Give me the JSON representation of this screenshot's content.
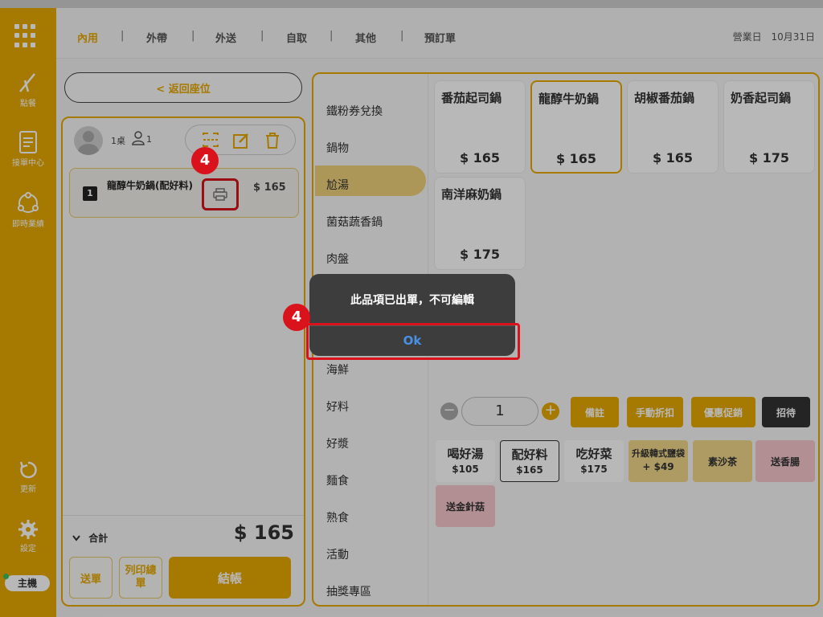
{
  "nav": {
    "tabs": [
      "內用",
      "外帶",
      "外送",
      "自取",
      "其他",
      "預訂單"
    ],
    "separator": "|",
    "business_day_label": "營業日",
    "date": "10月31日"
  },
  "sidebar": {
    "items": [
      {
        "label": "點餐",
        "icon": "pencil-icon"
      },
      {
        "label": "接單中心",
        "icon": "clipboard-icon"
      },
      {
        "label": "即時業績",
        "icon": "network-icon"
      },
      {
        "label": "更新",
        "icon": "refresh-icon"
      },
      {
        "label": "設定",
        "icon": "gear-icon"
      }
    ],
    "host_label": "主機"
  },
  "order": {
    "back_label": "< 返回座位",
    "table": "1桌",
    "guests": "1",
    "item": {
      "qty": "1",
      "name": "龍醇牛奶鍋(配好料)",
      "price": "$ 165"
    },
    "total_label": "合計",
    "total_value": "$ 165",
    "send_label": "送單",
    "print_total_label": "列印總單",
    "checkout_label": "結帳"
  },
  "menu": {
    "categories": [
      "鐵粉券兌換",
      "鍋物",
      "尬湯",
      "菌菇蔬香鍋",
      "肉盤",
      "海鮮",
      "好料",
      "好漿",
      "麵食",
      "熟食",
      "活動",
      "抽獎專區"
    ],
    "active_category": "尬湯",
    "dishes": [
      {
        "name": "番茄起司鍋",
        "price": "$ 165"
      },
      {
        "name": "龍醇牛奶鍋",
        "price": "$ 165"
      },
      {
        "name": "胡椒番茄鍋",
        "price": "$ 165"
      },
      {
        "name": "奶香起司鍋",
        "price": "$ 175"
      },
      {
        "name": "南洋麻奶鍋",
        "price": "$ 175"
      }
    ],
    "quantity": "1",
    "actions": [
      "備註",
      "手動折扣",
      "優惠促銷",
      "招待"
    ],
    "options": [
      {
        "name": "喝好湯",
        "price": "$105"
      },
      {
        "name": "配好料",
        "price": "$165"
      },
      {
        "name": "吃好菜",
        "price": "$175"
      },
      {
        "name": "升級韓式鹽袋",
        "price": "+ $49"
      },
      {
        "name": "素沙茶",
        "price": ""
      },
      {
        "name": "送香腸",
        "price": ""
      },
      {
        "name": "送金針菇",
        "price": ""
      }
    ]
  },
  "alert": {
    "message": "此品項已出單，不可編輯",
    "ok_label": "Ok"
  },
  "annotations": {
    "step_number": "4"
  },
  "colors": {
    "accent": "#e6a800",
    "highlight_red": "#d9121b",
    "ok_blue": "#4a90e2"
  }
}
